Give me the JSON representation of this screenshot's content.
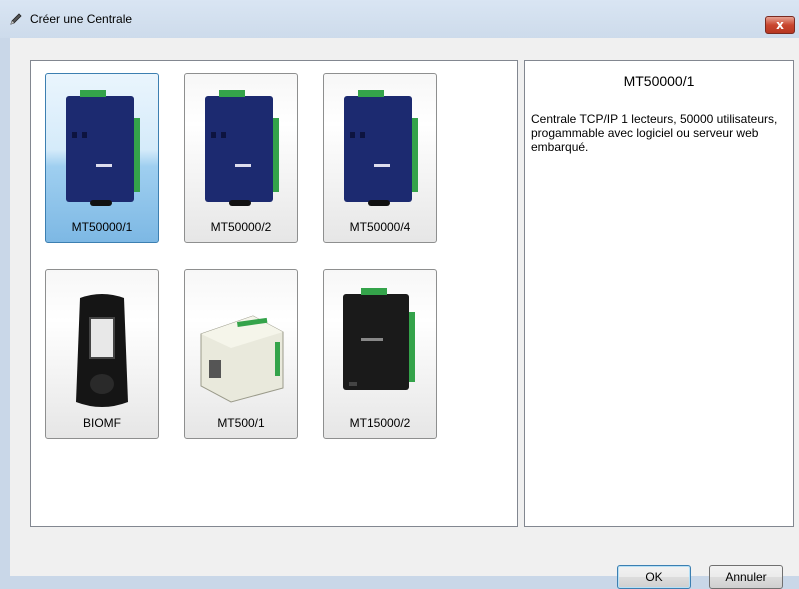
{
  "window": {
    "title": "Créer une Centrale",
    "close_label": "x"
  },
  "gallery": {
    "items": [
      {
        "label": "MT50000/1",
        "selected": true,
        "icon": "controller-board-icon"
      },
      {
        "label": "MT50000/2",
        "selected": false,
        "icon": "controller-board-icon"
      },
      {
        "label": "MT50000/4",
        "selected": false,
        "icon": "controller-board-icon"
      },
      {
        "label": "BIOMF",
        "selected": false,
        "icon": "fingerprint-reader-icon"
      },
      {
        "label": "MT500/1",
        "selected": false,
        "icon": "din-module-icon"
      },
      {
        "label": "MT15000/2",
        "selected": false,
        "icon": "black-board-icon"
      }
    ]
  },
  "description": {
    "title": "MT50000/1",
    "text": "Centrale TCP/IP 1 lecteurs, 50000 utilisateurs, progammable avec logiciel ou serveur web embarqué."
  },
  "buttons": {
    "ok_label": "OK",
    "cancel_label": "Annuler"
  },
  "colors": {
    "title_bar": "#d3e0ef",
    "selection": "#9fcff0",
    "board_blue": "#1a2a6c",
    "close_red": "#c9462f"
  }
}
